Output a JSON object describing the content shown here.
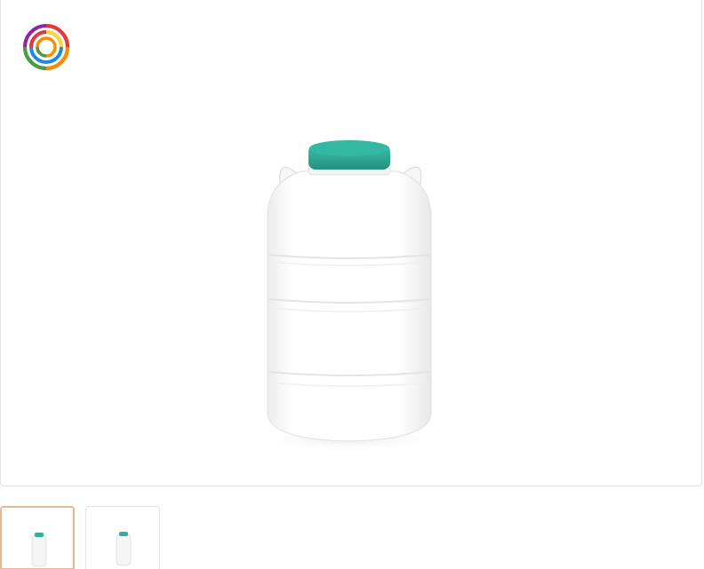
{
  "gallery": {
    "main_image": {
      "icon": "water-canister-icon",
      "cap_color": "#2fae9a",
      "body_color": "#ffffff"
    },
    "logo": {
      "icon": "rainbow-swirl-logo",
      "colors": [
        "#e53935",
        "#fb8c00",
        "#fdd835",
        "#43a047",
        "#1e88e5",
        "#8e24aa"
      ]
    },
    "thumbnails": [
      {
        "icon": "water-canister-thumbnail",
        "active": true,
        "accent": "#e7b894"
      },
      {
        "icon": "water-canister-thumbnail",
        "active": false,
        "accent": "#e3e3e3"
      }
    ]
  }
}
